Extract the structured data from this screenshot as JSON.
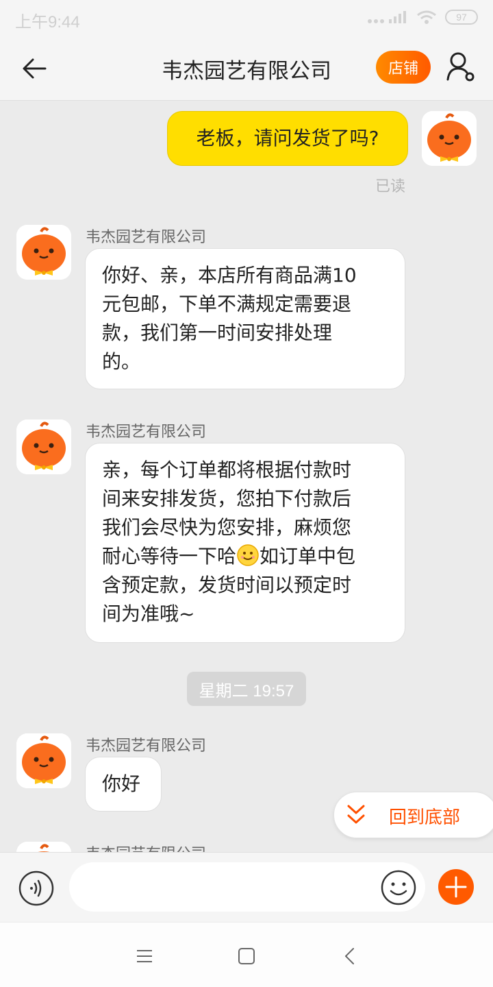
{
  "status_bar": {
    "time": "上午9:44",
    "battery": "97"
  },
  "header": {
    "title": "韦杰园艺有限公司",
    "shop_label": "店铺"
  },
  "messages": [
    {
      "from": "me",
      "text": "老板，请问发货了吗?",
      "read_status": "已读"
    },
    {
      "from": "shop",
      "sender": "韦杰园艺有限公司",
      "lines": [
        "你好、亲，本店所有商品满10",
        "元包邮，下单不满规定需要退",
        "款，我们第一时间安排处理",
        "的。"
      ]
    },
    {
      "from": "shop",
      "sender": "韦杰园艺有限公司",
      "lines": [
        "亲，每个订单都将根据付款时",
        "间来安排发货，您拍下付款后",
        "我们会尽快为您安排，麻烦您",
        "耐心等待一下哈",
        "如订单中包",
        "含预定款，发货时间以预定时",
        "间为准哦~"
      ]
    },
    {
      "from": "shop",
      "sender": "韦杰园艺有限公司",
      "text": "你好"
    },
    {
      "from": "shop",
      "sender": "韦杰园艺有限公司"
    }
  ],
  "time_divider": "星期二 19:57",
  "scroll_to_bottom_label": "回到底部",
  "colors": {
    "accent": "#ff5a00",
    "my_bubble": "#ffde00"
  }
}
